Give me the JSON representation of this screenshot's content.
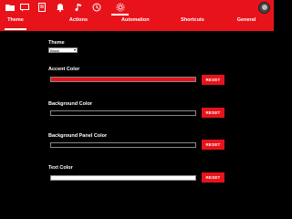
{
  "toolbar": {
    "icons": [
      "folder-icon",
      "chat-icon",
      "document-icon",
      "bell-icon",
      "music-icon",
      "history-icon",
      "settings-icon"
    ]
  },
  "tabs": [
    {
      "label": "Theme"
    },
    {
      "label": "Actions"
    },
    {
      "label": "Automation"
    },
    {
      "label": "Shortcuts"
    },
    {
      "label": "General"
    }
  ],
  "theme": {
    "heading": "Theme",
    "selected": "Black"
  },
  "colors": [
    {
      "label": "Accent Color",
      "value": "#e8131a",
      "reset_label": "RESET"
    },
    {
      "label": "Background Color",
      "value": "#000000",
      "reset_label": "RESET"
    },
    {
      "label": "Background Panel Color",
      "value": "#000000",
      "reset_label": "RESET"
    },
    {
      "label": "Text Color",
      "value": "#ffffff",
      "reset_label": "RESET"
    }
  ]
}
